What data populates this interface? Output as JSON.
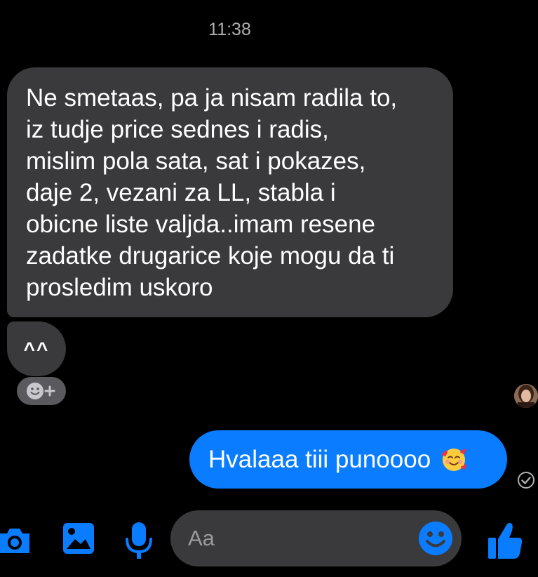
{
  "header": {
    "timestamp": "11:38"
  },
  "messages": {
    "incoming_1": {
      "lines": [
        "Ne smetaas, pa ja nisam radila to,",
        "iz tudje price sednes i radis,",
        "mislim pola sata, sat i pokazes,",
        "daje 2, vezani za LL, stabla i",
        "obicne liste valjda..imam resene",
        "zadatke drugarice koje mogu da ti",
        "prosledim uskoro"
      ]
    },
    "incoming_2": {
      "text": "^^"
    },
    "outgoing_1": {
      "text": "Hvalaaa tiii punoooo",
      "emoji": "smiling-face-with-hearts-emoji"
    }
  },
  "icons": {
    "reaction": "add-reaction-icon",
    "avatar": "contact-avatar",
    "seen": "delivered-check-icon",
    "camera": "camera-icon",
    "gallery": "gallery-icon",
    "mic": "microphone-icon",
    "emoji": "emoji-icon",
    "like": "thumbs-up-icon"
  },
  "composer": {
    "placeholder": "Aa"
  },
  "colors": {
    "background": "#000000",
    "incoming_bubble": "#3a3a3c",
    "outgoing_bubble": "#0a7cff",
    "accent": "#0a7cff"
  }
}
